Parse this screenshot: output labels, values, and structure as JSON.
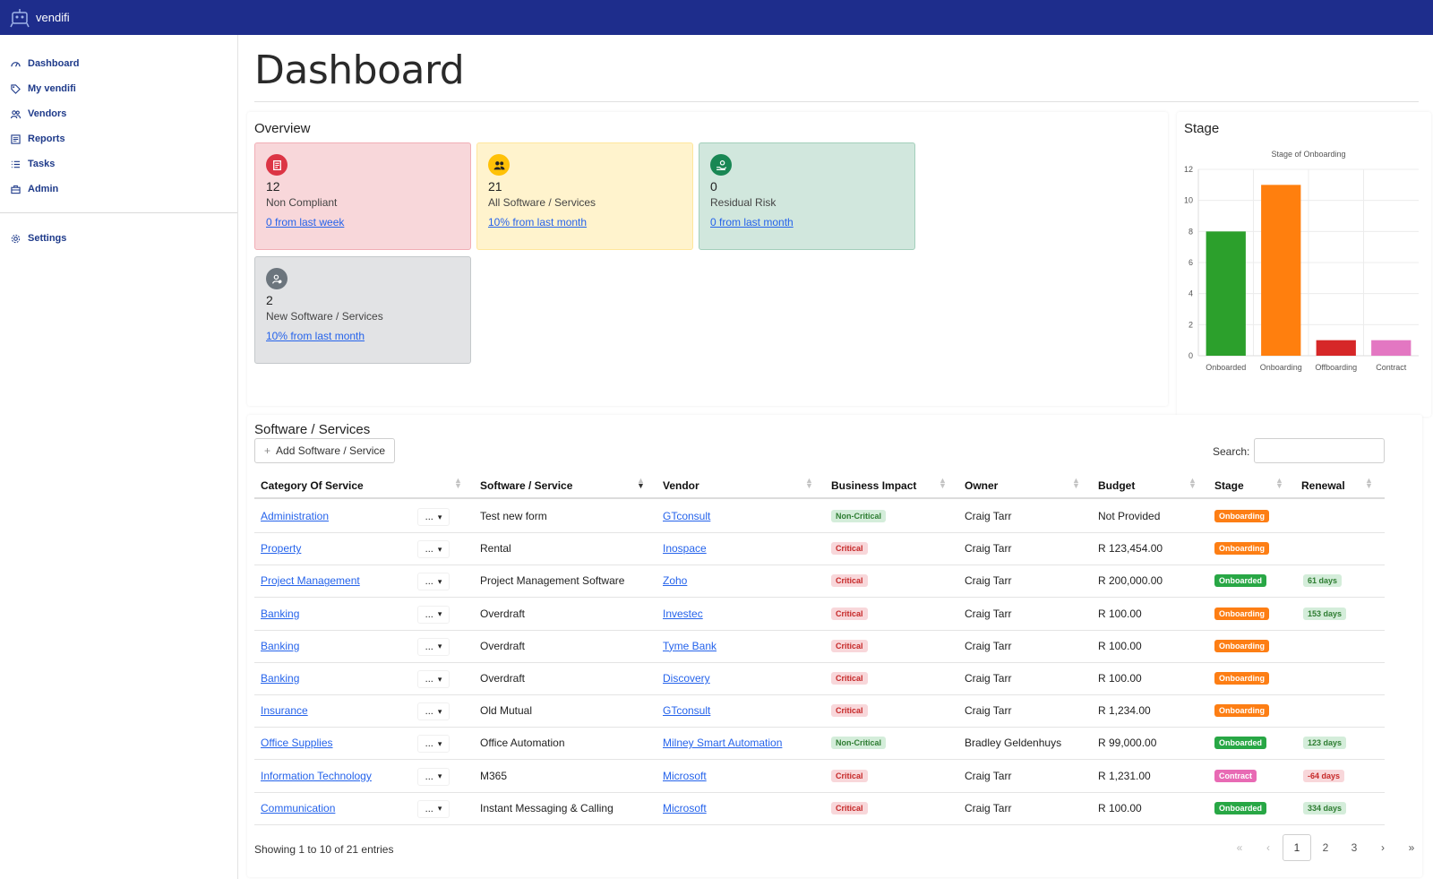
{
  "app": {
    "brand": "vendifi"
  },
  "sidebar": {
    "items": [
      {
        "label": "Dashboard",
        "icon": "gauge-icon"
      },
      {
        "label": "My vendifi",
        "icon": "tag-icon"
      },
      {
        "label": "Vendors",
        "icon": "users-icon"
      },
      {
        "label": "Reports",
        "icon": "report-icon"
      },
      {
        "label": "Tasks",
        "icon": "list-icon"
      },
      {
        "label": "Admin",
        "icon": "briefcase-icon"
      }
    ],
    "settings": {
      "label": "Settings",
      "icon": "gear-icon"
    }
  },
  "page": {
    "title": "Dashboard"
  },
  "overview": {
    "title": "Overview",
    "cards": [
      {
        "value": "12",
        "label": "Non Compliant",
        "link": "0 from last week",
        "color": "#dc3545"
      },
      {
        "value": "21",
        "label": "All Software / Services",
        "link": "10% from last month",
        "color": "#ffc107"
      },
      {
        "value": "0",
        "label": "Residual Risk",
        "link": "0 from last month",
        "color": "#198754"
      },
      {
        "value": "2",
        "label": "New Software / Services",
        "link": "10% from last month",
        "color": "#6c757d"
      }
    ]
  },
  "stage": {
    "title": "Stage"
  },
  "chart_data": {
    "type": "bar",
    "title": "Stage of Onboarding",
    "categories": [
      "Onboarded",
      "Onboarding",
      "Offboarding",
      "Contract"
    ],
    "values": [
      8,
      11,
      1,
      1
    ],
    "colors": [
      "#2ca02c",
      "#ff7f0e",
      "#d62728",
      "#e377c2"
    ],
    "ylim": [
      0,
      12
    ],
    "yticks": [
      0,
      2,
      4,
      6,
      8,
      10,
      12
    ],
    "grid": true,
    "legend": "none"
  },
  "services": {
    "title": "Software / Services",
    "add_label": "Add Software / Service",
    "search_label": "Search:",
    "search_value": "",
    "columns": [
      "Category Of Service",
      "Software / Service",
      "Vendor",
      "Business Impact",
      "Owner",
      "Budget",
      "Stage",
      "Renewal"
    ],
    "rows": [
      {
        "category": "Administration",
        "service": "Test new form",
        "vendor": "GTconsult",
        "impact": "Non-Critical",
        "owner": "Craig Tarr",
        "budget": "Not Provided",
        "stage": "Onboarding",
        "renewal": ""
      },
      {
        "category": "Property",
        "service": "Rental",
        "vendor": "Inospace",
        "impact": "Critical",
        "owner": "Craig Tarr",
        "budget": "R 123,454.00",
        "stage": "Onboarding",
        "renewal": ""
      },
      {
        "category": "Project Management",
        "service": "Project Management Software",
        "vendor": "Zoho",
        "impact": "Critical",
        "owner": "Craig Tarr",
        "budget": "R 200,000.00",
        "stage": "Onboarded",
        "renewal": "61 days"
      },
      {
        "category": "Banking",
        "service": "Overdraft",
        "vendor": "Investec",
        "impact": "Critical",
        "owner": "Craig Tarr",
        "budget": "R 100.00",
        "stage": "Onboarding",
        "renewal": "153 days"
      },
      {
        "category": "Banking",
        "service": "Overdraft",
        "vendor": "Tyme Bank",
        "impact": "Critical",
        "owner": "Craig Tarr",
        "budget": "R 100.00",
        "stage": "Onboarding",
        "renewal": ""
      },
      {
        "category": "Banking",
        "service": "Overdraft",
        "vendor": "Discovery",
        "impact": "Critical",
        "owner": "Craig Tarr",
        "budget": "R 100.00",
        "stage": "Onboarding",
        "renewal": ""
      },
      {
        "category": "Insurance",
        "service": "Old Mutual",
        "vendor": "GTconsult",
        "impact": "Critical",
        "owner": "Craig Tarr",
        "budget": "R 1,234.00",
        "stage": "Onboarding",
        "renewal": ""
      },
      {
        "category": "Office Supplies",
        "service": "Office Automation",
        "vendor": "Milney Smart Automation",
        "impact": "Non-Critical",
        "owner": "Bradley Geldenhuys",
        "budget": "R 99,000.00",
        "stage": "Onboarded",
        "renewal": "123 days"
      },
      {
        "category": "Information Technology",
        "service": "M365",
        "vendor": "Microsoft",
        "impact": "Critical",
        "owner": "Craig Tarr",
        "budget": "R 1,231.00",
        "stage": "Contract",
        "renewal": "-64 days"
      },
      {
        "category": "Communication",
        "service": "Instant Messaging & Calling",
        "vendor": "Microsoft",
        "impact": "Critical",
        "owner": "Craig Tarr",
        "budget": "R 100.00",
        "stage": "Onboarded",
        "renewal": "334 days"
      }
    ],
    "row_menu_label": "...",
    "info": "Showing 1 to 10 of 21 entries",
    "pager": {
      "first": "«",
      "prev": "‹",
      "pages": [
        "1",
        "2",
        "3"
      ],
      "next": "›",
      "last": "»",
      "active": "1"
    }
  }
}
